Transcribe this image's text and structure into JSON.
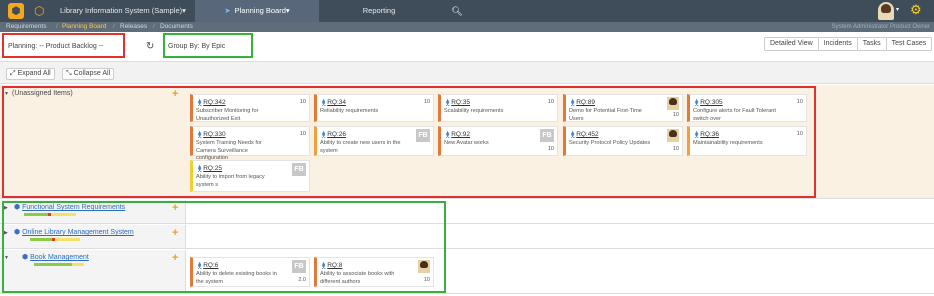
{
  "header": {
    "project_name": "Library Information System (Sample)",
    "project_caret": "▾",
    "nav_active": "Planning Board",
    "nav_reporting": "Reporting",
    "search_icon": "⌕",
    "logo_glyph": "⬢"
  },
  "breadcrumb": {
    "items": [
      "Requirements",
      "Planning Board",
      "Releases",
      "Documents"
    ],
    "separator": "/",
    "user_line": "System Administrator  Product Owner"
  },
  "toolbar": {
    "planning_label": "Planning:",
    "planning_value": "-- Product Backlog --",
    "refresh_icon": "↻",
    "groupby_label": "Group By:",
    "groupby_value": "By Epic",
    "views": [
      "Detailed View",
      "Incidents",
      "Tasks",
      "Test Cases"
    ]
  },
  "expand": {
    "expand_label": "Expand All",
    "collapse_label": "Collapse All"
  },
  "groups": {
    "unassigned": "(Unassigned Items)",
    "functional": "Functional System Requirements",
    "online": "Online Library Management System",
    "book": "Book Management"
  },
  "cards": {
    "rq342": {
      "id": "RQ:342",
      "desc": "Subscriber Monitoring for Unauthorized Exit",
      "points": "10"
    },
    "rq34": {
      "id": "RQ:34",
      "desc": "Reliability requirements",
      "points": "10"
    },
    "rq35": {
      "id": "RQ:35",
      "desc": "Scalability requirements",
      "points": "10"
    },
    "rq89": {
      "id": "RQ:89",
      "desc": "Demo for Potential First-Time Users",
      "points": "10"
    },
    "rq305": {
      "id": "RQ:305",
      "desc": "Configure alerts for Fault Tolerant switch over",
      "points": "10"
    },
    "rq330": {
      "id": "RQ:330",
      "desc": "System Training Needs for Camera Surveillance configuration",
      "points": "10"
    },
    "rq26": {
      "id": "RQ:26",
      "desc": "Ability to create new users in the system",
      "points": "FB"
    },
    "rq92": {
      "id": "RQ:92",
      "desc": "New Avatar works",
      "points": "10"
    },
    "rq452": {
      "id": "RQ:452",
      "desc": "Security Protocol Policy Updates",
      "points": "10"
    },
    "rq36": {
      "id": "RQ:36",
      "desc": "Maintainability requirements",
      "points": "10"
    },
    "rq25": {
      "id": "RQ:25",
      "desc": "Ability to import from legacy system s",
      "points": "FB"
    },
    "rq6": {
      "id": "RQ:6",
      "desc": "Ability to delete existing books in the system",
      "points": "2.0"
    },
    "rq8": {
      "id": "RQ:8",
      "desc": "Ability to associate books with different authors",
      "points": "10"
    }
  },
  "fb_badge": "FB",
  "colors": {
    "topbar": "#3f4d5a",
    "accent": "#f6a81c",
    "highlight_red": "#e03030",
    "highlight_green": "#38b040"
  }
}
